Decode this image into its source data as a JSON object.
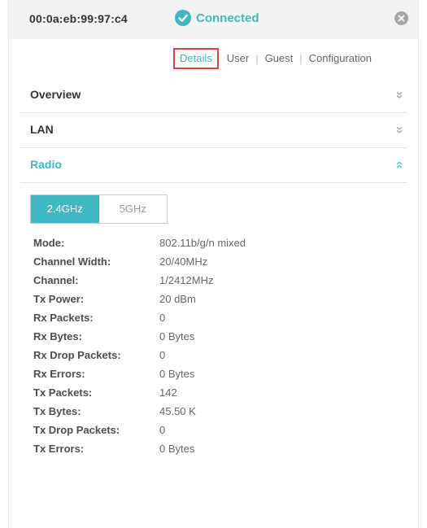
{
  "header": {
    "mac": "00:0a:eb:99:97:c4",
    "status": "Connected"
  },
  "tabs": [
    {
      "label": "Details"
    },
    {
      "label": "User"
    },
    {
      "label": "Guest"
    },
    {
      "label": "Configuration"
    }
  ],
  "tab_separator": "|",
  "sections": {
    "overview": "Overview",
    "lan": "LAN",
    "radio": "Radio"
  },
  "bands": {
    "selected": "2.4GHz",
    "other": "5GHz"
  },
  "stats": [
    {
      "label": "Mode:",
      "value": "802.11b/g/n mixed"
    },
    {
      "label": "Channel Width:",
      "value": "20/40MHz"
    },
    {
      "label": "Channel:",
      "value": "1/2412MHz"
    },
    {
      "label": "Tx Power:",
      "value": "20 dBm"
    },
    {
      "label": "Rx Packets:",
      "value": "0"
    },
    {
      "label": "Rx Bytes:",
      "value": "0 Bytes"
    },
    {
      "label": "Rx Drop Packets:",
      "value": "0"
    },
    {
      "label": "Rx Errors:",
      "value": "0 Bytes"
    },
    {
      "label": "Tx Packets:",
      "value": "142"
    },
    {
      "label": "Tx Bytes:",
      "value": "45.50 K"
    },
    {
      "label": "Tx Drop Packets:",
      "value": "0"
    },
    {
      "label": "Tx Errors:",
      "value": "0 Bytes"
    }
  ],
  "colors": {
    "accent": "#3fb8c0",
    "active_tab_border": "#d9433f",
    "header_bg": "#f3f3f3"
  },
  "icons": {
    "status": "check-circle-icon",
    "close": "close-circle-icon",
    "collapsed": "double-chevron-down-icon",
    "expanded": "double-chevron-up-icon"
  }
}
